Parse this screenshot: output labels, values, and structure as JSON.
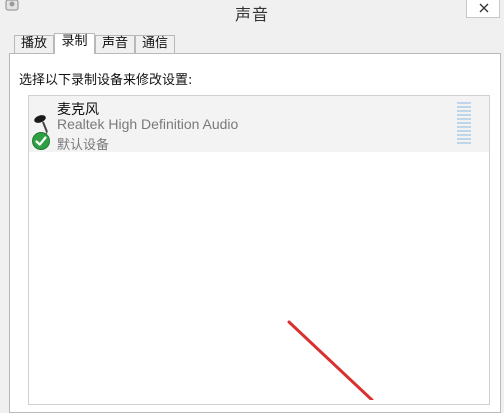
{
  "window": {
    "title": "声音",
    "system_icon": "speaker-icon",
    "close_icon": "close-icon"
  },
  "tabs": [
    {
      "label": "播放",
      "active": false
    },
    {
      "label": "录制",
      "active": true
    },
    {
      "label": "声音",
      "active": false
    },
    {
      "label": "通信",
      "active": false
    }
  ],
  "recording": {
    "instruction": "选择以下录制设备来修改设置:",
    "devices": [
      {
        "name": "麦克风",
        "driver": "Realtek High Definition Audio",
        "status": "默认设备",
        "icon": "microphone-icon",
        "badge": "default-checkmark-icon",
        "level": 0
      }
    ]
  },
  "annotation": {
    "arrow_color": "#d93030"
  }
}
